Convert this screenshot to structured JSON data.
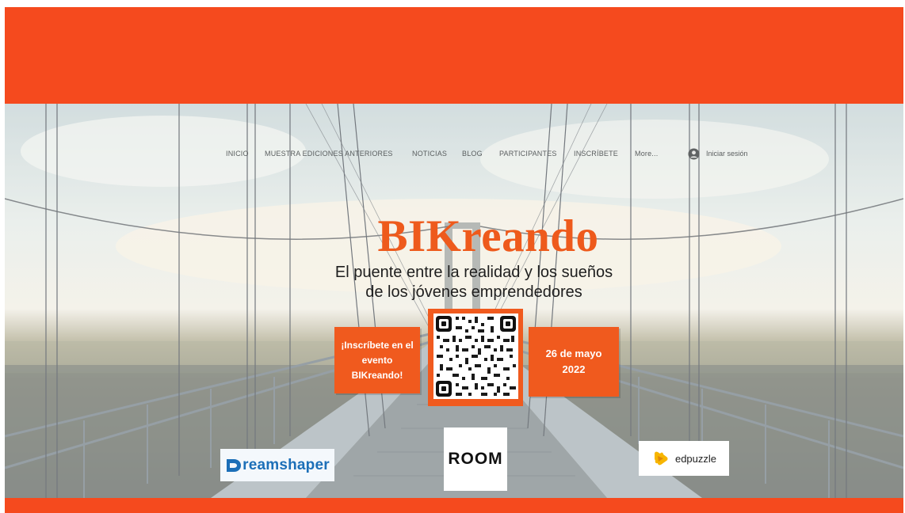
{
  "colors": {
    "accent": "#f54a1e",
    "title_orange": "#ee5a1c",
    "box_orange": "#f05a1e"
  },
  "nav": {
    "items": [
      {
        "label": "INICIO"
      },
      {
        "label": "MUESTRA EDICIONES ANTERIORES"
      },
      {
        "label": "NOTICIAS"
      },
      {
        "label": "BLOG"
      },
      {
        "label": "PARTICIPANTES"
      },
      {
        "label": "INSCRÍBETE"
      },
      {
        "label": "More..."
      }
    ],
    "login_label": "Iniciar sesión",
    "login_icon": "user-avatar-icon"
  },
  "hero": {
    "title": "BIKreando",
    "tagline_line1": "El puente entre la realidad y los sueños",
    "tagline_line2": "de los jóvenes emprendedores",
    "cta_line1": "¡Inscríbete en el",
    "cta_line2": "evento",
    "cta_line3": "BIKreando!",
    "date_line1": "26 de mayo",
    "date_line2": "2022",
    "qr_icon": "qr-code-icon"
  },
  "sponsors": {
    "dreamshaper": "reamshaper",
    "room": "ROOM",
    "edpuzzle": "edpuzzle"
  }
}
